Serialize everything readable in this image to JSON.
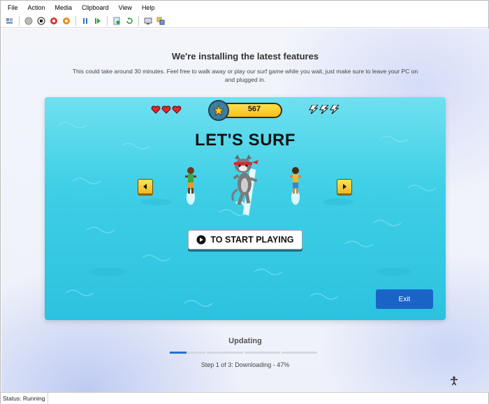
{
  "menu": [
    "File",
    "Action",
    "Media",
    "Clipboard",
    "View",
    "Help"
  ],
  "toolbar": {
    "icons": [
      "ctrl-alt-del-icon",
      "start-icon",
      "turn-off-icon",
      "shut-down-icon",
      "save-icon",
      "pause-icon",
      "resume-icon",
      "checkpoint-icon",
      "revert-icon",
      "enhanced-session-icon",
      "share-icon"
    ]
  },
  "setup": {
    "title": "We're installing the latest features",
    "subtitle": "This could take around 30 minutes. Feel free to walk away or play our surf game while you wait, just make sure to leave your PC on and plugged in."
  },
  "game": {
    "score": "567",
    "lives": 3,
    "boosts": 3,
    "title": "LET'S SURF",
    "play_label": "TO START PLAYING",
    "exit_label": "Exit",
    "colors": {
      "water": "#3fcfe6",
      "score_pill": "#f5c01a",
      "exit": "#1a64c8"
    }
  },
  "progress": {
    "heading": "Updating",
    "step_text": "Step 1 of 3: Downloading - 47%",
    "segments_total": 4,
    "segments_completed": 0,
    "current_segment_fill": 0.47,
    "accent": "#2a6fcc"
  },
  "status": {
    "text": "Status: Running"
  }
}
